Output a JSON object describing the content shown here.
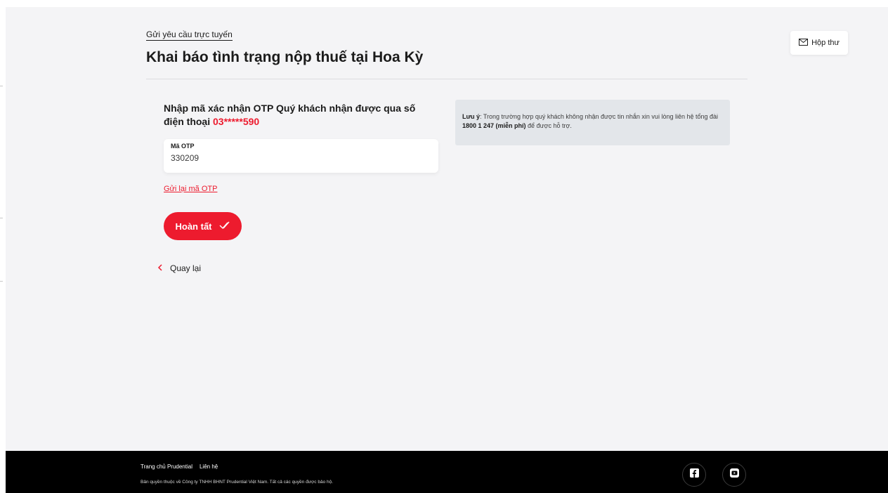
{
  "header": {
    "breadcrumb": "Gửi yêu cầu trực tuyến",
    "title": "Khai báo tình trạng nộp thuế tại Hoa Kỳ",
    "inbox_label": "Hộp thư"
  },
  "otp": {
    "heading_text": "Nhập mã xác nhận OTP Quý khách nhận được qua số điện thoại ",
    "phone": "03*****590",
    "field_label": "Mã OTP",
    "field_value": "330209",
    "resend_label": "Gửi lại mã OTP",
    "submit_label": "Hoàn tất",
    "back_label": "Quay lại"
  },
  "note": {
    "label": "Lưu ý",
    "text_before": ": Trong trường hợp quý khách không nhận được tin nhắn xin vui lòng liên hệ tổng đài ",
    "hotline": "1800 1 247 (miễn phí)",
    "text_after": " để được hỗ trợ."
  },
  "footer": {
    "home_link": "Trang chủ Prudential",
    "contact_link": "Liên hệ",
    "copyright": "Bản quyền thuộc về Công ty TNHH BHNT Prudential Việt Nam. Tất cả các quyền được bảo hộ."
  },
  "icons": {
    "inbox": "envelope-icon",
    "submit": "double-check-icon",
    "back": "chevron-left-icon",
    "facebook": "facebook-icon",
    "youtube": "youtube-icon"
  },
  "colors": {
    "brand_red": "#ed1b2e",
    "page_bg": "#f4f4f6",
    "note_bg": "#e3e6ea",
    "footer_bg": "#000000"
  }
}
